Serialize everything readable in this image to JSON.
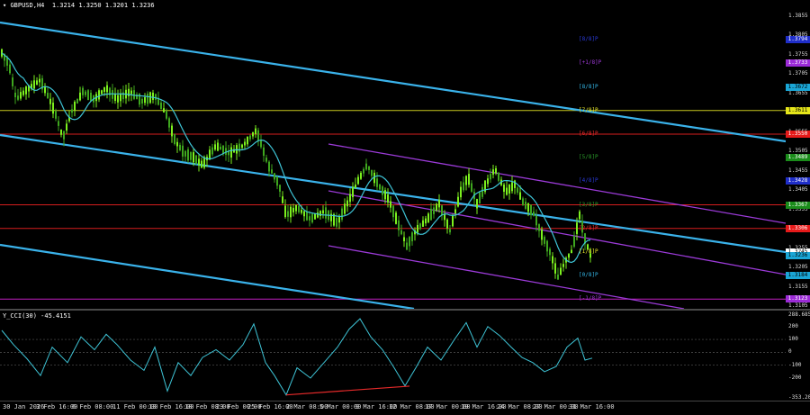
{
  "header": {
    "symbol_label": "GBPUSD,H4",
    "ohlc": "1.3214 1.3250 1.3201 1.3236"
  },
  "indicator": {
    "label": "Y_CCI(30) -45.4151"
  },
  "price_axis": {
    "ticks": [
      "1.3855",
      "1.3805",
      "1.3755",
      "1.3705",
      "1.3655",
      "1.3605",
      "1.3555",
      "1.3505",
      "1.3455",
      "1.3405",
      "1.3355",
      "1.3305",
      "1.3255",
      "1.3205",
      "1.3155",
      "1.3105"
    ]
  },
  "price_tags": [
    {
      "text": "1.3794",
      "price": 1.3794,
      "color": "#1f2ec9",
      "fg": "#ffffff"
    },
    {
      "text": "1.3733",
      "price": 1.3733,
      "color": "#9b2bd6",
      "fg": "#ffffff"
    },
    {
      "text": "1.3672",
      "price": 1.3672,
      "color": "#1aa6d6",
      "fg": "#000000"
    },
    {
      "text": "1.3611",
      "price": 1.3611,
      "color": "#e6e61a",
      "fg": "#000000"
    },
    {
      "text": "1.3550",
      "price": 1.355,
      "color": "#e61a1a",
      "fg": "#ffffff"
    },
    {
      "text": "1.3489",
      "price": 1.3489,
      "color": "#1a8c1a",
      "fg": "#ffffff"
    },
    {
      "text": "1.3428",
      "price": 1.3428,
      "color": "#1f2ec9",
      "fg": "#ffffff"
    },
    {
      "text": "1.3367",
      "price": 1.3367,
      "color": "#1a8c1a",
      "fg": "#ffffff"
    },
    {
      "text": "1.3306",
      "price": 1.3306,
      "color": "#e61a1a",
      "fg": "#ffffff"
    },
    {
      "text": "1.3245",
      "price": 1.3245,
      "color": "#ffffff",
      "fg": "#000000"
    },
    {
      "text": "1.3236",
      "price": 1.3236,
      "color": "#1aa6d6",
      "fg": "#000000"
    },
    {
      "text": "1.3184",
      "price": 1.3184,
      "color": "#1aa6d6",
      "fg": "#000000"
    },
    {
      "text": "1.3123",
      "price": 1.3123,
      "color": "#9b2bd6",
      "fg": "#ffffff"
    }
  ],
  "murrey_labels": [
    {
      "text": "[8/8]P",
      "price": 1.3794,
      "color": "#2a3ad9"
    },
    {
      "text": "[+1/8]P",
      "price": 1.3733,
      "color": "#a03ad9"
    },
    {
      "text": "[8/8]P",
      "price": 1.3672,
      "color": "#34b6e6"
    },
    {
      "text": "[7/8]P",
      "price": 1.3611,
      "color": "#e6e62a"
    },
    {
      "text": "[6/8]P",
      "price": 1.355,
      "color": "#e62a2a"
    },
    {
      "text": "[5/8]P",
      "price": 1.3489,
      "color": "#2a9c2a"
    },
    {
      "text": "[4/8]P",
      "price": 1.3428,
      "color": "#2a3ad9"
    },
    {
      "text": "[3/8]P",
      "price": 1.3367,
      "color": "#2a9c2a"
    },
    {
      "text": "[2/8]P",
      "price": 1.3306,
      "color": "#e62a2a"
    },
    {
      "text": "[1/8]P",
      "price": 1.3245,
      "color": "#e6e62a"
    },
    {
      "text": "[0/8]P",
      "price": 1.3184,
      "color": "#34b6e6"
    },
    {
      "text": "[-1/8]P",
      "price": 1.3123,
      "color": "#a03ad9"
    }
  ],
  "murrey_lines": [
    {
      "price": 1.3611,
      "color": "#c8c81e"
    },
    {
      "price": 1.355,
      "color": "#d61e1e"
    },
    {
      "price": 1.3367,
      "color": "#d61e1e"
    },
    {
      "price": 1.3306,
      "color": "#d61e1e"
    },
    {
      "price": 1.3123,
      "color": "#c01ec0"
    }
  ],
  "osc_axis": {
    "ticks": [
      "288.6855",
      "200",
      "100",
      "0",
      "-100",
      "-200",
      "-353.207"
    ]
  },
  "time_axis": {
    "labels": [
      "30 Jan 2026",
      "3 Feb 16:00",
      "6 Feb 08:00",
      "11 Feb 00:00",
      "13 Feb 16:00",
      "18 Feb 08:00",
      "23 Feb 00:00",
      "25 Feb 16:00",
      "2 Mar 08:00",
      "5 Mar 00:00",
      "9 Mar 16:00",
      "12 Mar 08:00",
      "17 Mar 00:00",
      "19 Mar 16:00",
      "24 Mar 08:00",
      "27 Mar 00:00",
      "31 Mar 16:00"
    ]
  },
  "colors": {
    "up_candle": "#7cf01e",
    "down_candle": "#3ea61e",
    "ma": "#3ec4d6",
    "channel_blue": "#3ab2ea",
    "channel_purple": "#9a3ad6",
    "cci_line": "#3ec4d6",
    "divergence": "#e62a2a"
  }
}
